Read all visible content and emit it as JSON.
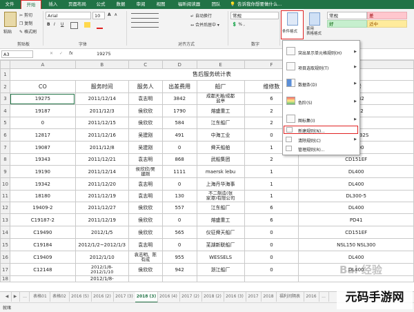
{
  "ribbon_tabs": [
    "文件",
    "开始",
    "插入",
    "页面布局",
    "公式",
    "数据",
    "审阅",
    "视图",
    "福昕阅读器",
    "团队"
  ],
  "tell_me": "告诉我你想要做什么...",
  "clipboard": {
    "paste": "粘贴",
    "cut": "剪切",
    "copy": "复制",
    "format_painter": "格式刷",
    "group": "剪贴板"
  },
  "font": {
    "name": "Arial",
    "size": "10",
    "bold": "B",
    "italic": "I",
    "underline": "U",
    "grow": "A",
    "shrink": "A",
    "group": "字体"
  },
  "alignment": {
    "wrap": "自动换行",
    "merge": "合并后居中",
    "group": "对齐方式"
  },
  "number": {
    "format": "常规",
    "group": "数字"
  },
  "styles": {
    "cond_format": "条件格式",
    "table_format": "套用\n表格格式",
    "cell_normal": "常规",
    "cell_bad": "差",
    "cell_good": "好",
    "cell_neutral": "适中"
  },
  "formula_bar": {
    "name_box": "A3",
    "fx": "fx",
    "value": "19275"
  },
  "columns": [
    "A",
    "B",
    "C",
    "D",
    "E",
    "F",
    "G"
  ],
  "table": {
    "title": "售后服务统计表",
    "headers": [
      "CO",
      "服务时间",
      "服务人",
      "出差费用",
      "船厂",
      "维修数",
      "型号"
    ],
    "rows": [
      [
        "19275",
        "2011/12/14",
        "袁志明",
        "3842",
        "成都天瀚/成都\n盐亭",
        "6",
        "1U2B2"
      ],
      [
        "19187",
        "2011/12/3",
        "侯欣欣",
        "1790",
        "熔盛重工",
        "2",
        "5/D02"
      ],
      [
        "0",
        "2011/12/15",
        "侯欣欣",
        "584",
        "江东船厂",
        "2",
        "5"
      ],
      [
        "12817",
        "2011/12/16",
        "吴建刚",
        "491",
        "中海工业",
        "0",
        "M-1U2B2S"
      ],
      [
        "19087",
        "2011/12/8",
        "吴建刚",
        "0",
        "舜天船舶",
        "1",
        "DL300"
      ],
      [
        "19343",
        "2011/12/21",
        "袁志明",
        "868",
        "武船集团",
        "2",
        "CD151EF"
      ],
      [
        "19190",
        "2011/12/14",
        "侯欣欣/吴\n建刚",
        "1111",
        "maersk lebu",
        "1",
        "DL400"
      ],
      [
        "19342",
        "2011/12/20",
        "袁志明",
        "0",
        "上海丹华海事",
        "1",
        "DL400"
      ],
      [
        "18180",
        "2011/12/19",
        "袁志明",
        "130",
        "不二制造(张\n家港)有限公司",
        "1",
        "DL300-5"
      ],
      [
        "19409-2",
        "2011/12/27",
        "侯欣欣",
        "557",
        "江东船厂",
        "6",
        "DL400"
      ],
      [
        "C19187-2",
        "2011/12/19",
        "侯欣欣",
        "0",
        "熔盛重工",
        "6",
        "PD41"
      ],
      [
        "C19490",
        "2012/1/5",
        "侯欣欣",
        "565",
        "仪征舜天船厂",
        "0",
        "CD151EF"
      ],
      [
        "C19184",
        "2012/1/2~2012/1/3",
        "袁志明",
        "0",
        "芜湖新联船厂",
        "0",
        "NSL150 NSL300"
      ],
      [
        "C19409",
        "2012/1/10",
        "袁志明、陈\n有成",
        "955",
        "WESSELS",
        "0",
        "DL400"
      ],
      [
        "C12148",
        "2012/1/8-\n2012/1/10",
        "侯欣欣",
        "942",
        "浙江船厂",
        "0",
        "DL400"
      ],
      [
        "",
        "2012/1/8-",
        "",
        "",
        "",
        "",
        ""
      ]
    ]
  },
  "menu": {
    "items": [
      "突出显示单元格规则(H)",
      "项目选取规则(T)",
      "数据条(D)",
      "色阶(S)",
      "图标集(I)",
      "新建规则(N)...",
      "清除规则(C)",
      "管理规则(R)..."
    ]
  },
  "sheet_tabs": [
    "表格01",
    "表格02",
    "2016 (5)",
    "2016 (2)",
    "2017 (3)",
    "2018 (3)",
    "2016 (4)",
    "2017 (2)",
    "2018 (2)",
    "2016 (3)",
    "2017",
    "2018",
    "福利间隔表",
    "2016",
    "..."
  ],
  "active_sheet": "2018 (3)",
  "status": "就绪",
  "watermark": "Bai 经验",
  "corner_brand": "元码手游网"
}
